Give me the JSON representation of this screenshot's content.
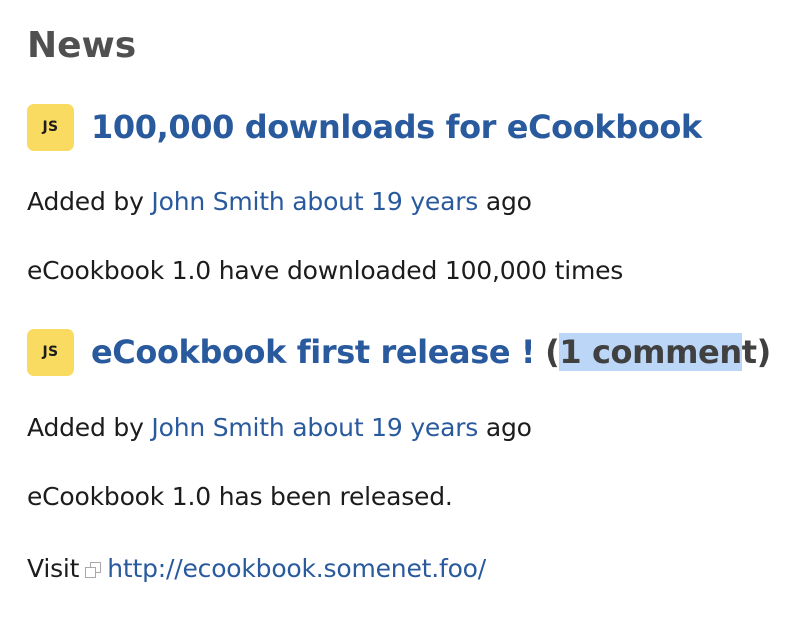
{
  "page": {
    "title": "News"
  },
  "news": [
    {
      "avatar_initials": "JS",
      "title": "100,000 downloads for eCookbook",
      "added_by_prefix": "Added by",
      "author": "John Smith",
      "age": "about 19 years",
      "age_suffix": "ago",
      "summary": "eCookbook 1.0 have downloaded 100,000 times"
    },
    {
      "avatar_initials": "JS",
      "title": "eCookbook first release !",
      "comments_open": "(",
      "comments_count_first": "1 commen",
      "comments_count_last": "t",
      "comments_close": ")",
      "added_by_prefix": "Added by",
      "author": "John Smith",
      "age": "about 19 years",
      "age_suffix": "ago",
      "summary": "eCookbook 1.0 has been released.",
      "visit_label": "Visit",
      "visit_url": "http://ecookbook.somenet.foo/"
    }
  ],
  "colors": {
    "link": "#2a5a9e",
    "heading": "#505050",
    "avatar_bg": "#f8db60",
    "selection": "#bcd6f7"
  },
  "icons": {
    "external_link": "external-link-icon"
  }
}
